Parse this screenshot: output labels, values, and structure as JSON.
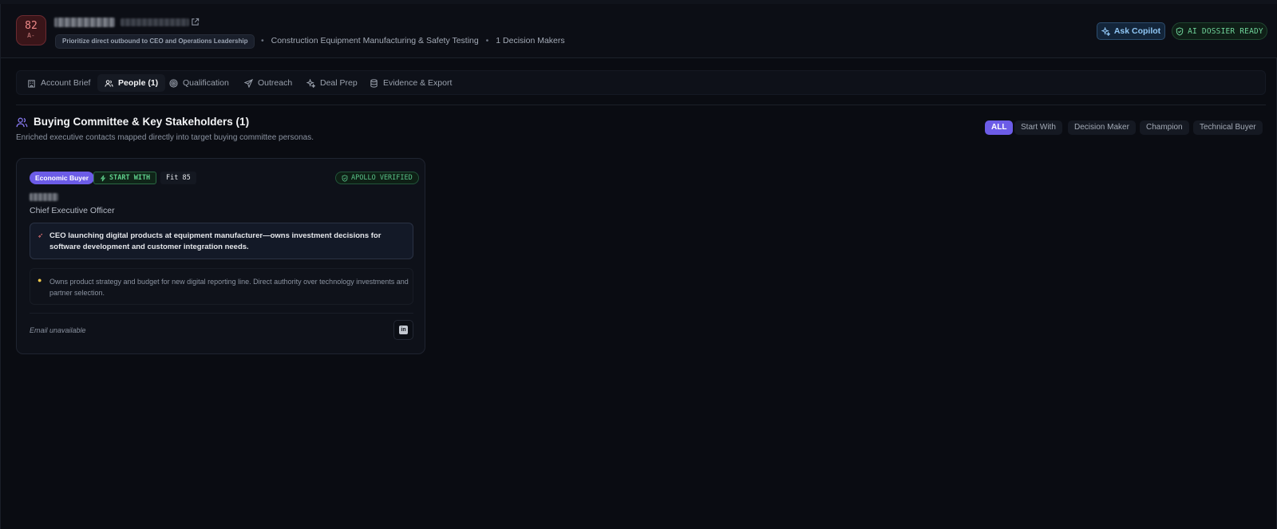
{
  "header": {
    "score": "82",
    "grade": "A-",
    "priority": "Prioritize direct outbound to CEO and Operations Leadership",
    "industry": "Construction Equipment Manufacturing & Safety Testing",
    "decision_makers": "1 Decision Makers",
    "ask_copilot_label": "Ask Copilot",
    "ai_status_label": "AI DOSSIER READY"
  },
  "tabs": [
    {
      "label": "Account Brief",
      "icon": "building-icon"
    },
    {
      "label": "People (1)",
      "icon": "users-icon",
      "active": true
    },
    {
      "label": "Qualification",
      "icon": "target-icon"
    },
    {
      "label": "Outreach",
      "icon": "send-icon"
    },
    {
      "label": "Deal Prep",
      "icon": "sparkles-icon"
    },
    {
      "label": "Evidence & Export",
      "icon": "database-icon"
    }
  ],
  "section": {
    "title": "Buying Committee & Key Stakeholders (1)",
    "subtitle": "Enriched executive contacts mapped directly into target buying committee personas."
  },
  "filters": [
    {
      "label": "ALL",
      "active": true
    },
    {
      "label": "Start With"
    },
    {
      "label": "Decision Maker"
    },
    {
      "label": "Champion"
    },
    {
      "label": "Technical Buyer"
    }
  ],
  "contact": {
    "role_badge": "Economic Buyer",
    "start_with_label": "START WITH",
    "fit_label": "Fit 85",
    "verified_label": "APOLLO VERIFIED",
    "title": "Chief Executive Officer",
    "insight": "CEO launching digital products at equipment manufacturer—owns investment decisions for software development and customer integration needs.",
    "note": "Owns product strategy and budget for new digital reporting line. Direct authority over technology investments and partner selection.",
    "email_status": "Email unavailable",
    "linkedin_label": "in"
  },
  "colors": {
    "accent": "#6c5ce7",
    "success": "#5fd08c",
    "score": "#f08a8a"
  }
}
